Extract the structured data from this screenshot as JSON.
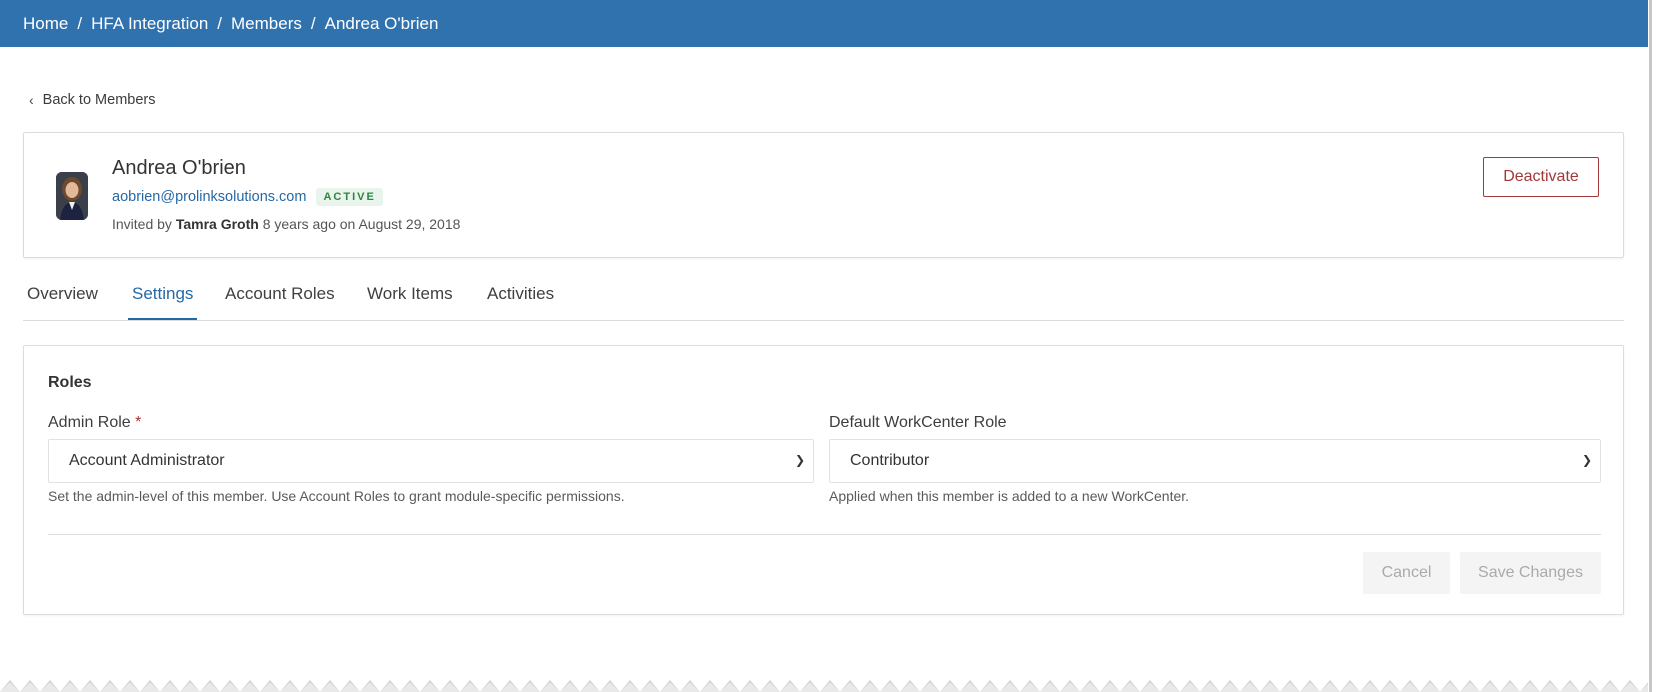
{
  "breadcrumb": {
    "items": [
      "Home",
      "HFA Integration",
      "Members",
      "Andrea O'brien"
    ],
    "separator": "/"
  },
  "back_link": {
    "label": "Back to Members",
    "icon": "chevron-left-icon"
  },
  "profile": {
    "name": "Andrea O'brien",
    "email": "aobrien@prolinksolutions.com",
    "status": "ACTIVE",
    "invited_prefix": "Invited by",
    "invited_by": "Tamra Groth",
    "invited_suffix": "8 years ago on August 29, 2018",
    "deactivate_label": "Deactivate"
  },
  "tabs": [
    {
      "label": "Overview",
      "active": false
    },
    {
      "label": "Settings",
      "active": true
    },
    {
      "label": "Account Roles",
      "active": false
    },
    {
      "label": "Work Items",
      "active": false
    },
    {
      "label": "Activities",
      "active": false
    }
  ],
  "roles": {
    "title": "Roles",
    "admin_role": {
      "label": "Admin Role",
      "required_mark": "*",
      "value": "Account Administrator",
      "help": "Set the admin-level of this member. Use Account Roles to grant module-specific permissions."
    },
    "workcenter_role": {
      "label": "Default WorkCenter Role",
      "value": "Contributor",
      "help": "Applied when this member is added to a new WorkCenter."
    },
    "cancel_label": "Cancel",
    "save_label": "Save Changes"
  },
  "colors": {
    "header_bg": "#3072ae",
    "accent": "#2568a6",
    "danger": "#a33838",
    "active_badge": "#2e8540"
  }
}
